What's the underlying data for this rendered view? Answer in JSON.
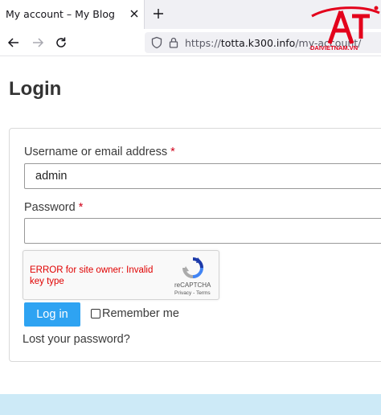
{
  "browser": {
    "tab_title": "My account – My Blog",
    "url_prefix": "https://",
    "url_host": "totta.k300.info",
    "url_path": "/my-account/"
  },
  "watermark": {
    "text": "DAIVIETNAM.VN",
    "color": "#e3001b"
  },
  "page": {
    "title": "Login"
  },
  "form": {
    "username_label": "Username or email address",
    "username_value": "admin",
    "password_label": "Password",
    "password_value": "",
    "required_mark": "*",
    "captcha_error": "ERROR for site owner: Invalid key type",
    "captcha_brand": "reCAPTCHA",
    "captcha_links": "Privacy - Terms",
    "login_button": "Log in",
    "remember_label": "Remember me",
    "remember_checked": false,
    "lost_password": "Lost your password?"
  },
  "colors": {
    "accent": "#2ea3f2",
    "error": "#e00000",
    "footer_band": "#cdeaf7"
  }
}
